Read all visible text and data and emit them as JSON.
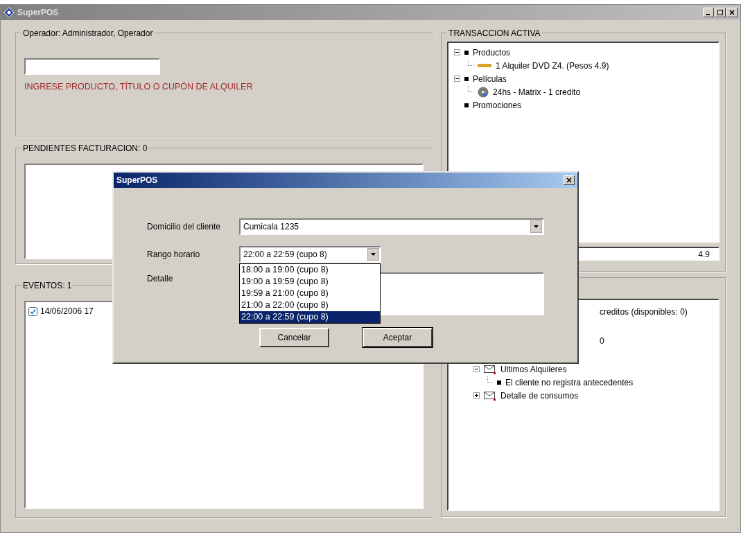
{
  "window": {
    "title": "SuperPOS"
  },
  "operator_panel": {
    "title": "Operador: Administrador, Operador",
    "hint": "INGRESE PRODUCTO, TÍTULO O CUPÓN DE ALQUILER"
  },
  "pending_panel": {
    "title": "PENDIENTES FACTURACION: 0"
  },
  "events_panel": {
    "title": "EVENTOS: 1",
    "items": [
      {
        "text": "14/06/2006 17",
        "checked": true
      }
    ]
  },
  "transaction_panel": {
    "title": "TRANSACCION ACTIVA",
    "total": "4.9",
    "tree": [
      {
        "label": "Productos",
        "kind": "bullet",
        "expanded": true,
        "children": [
          {
            "label": "1 Alquiler DVD Z4. (Pesos 4.9)",
            "kind": "ticket"
          }
        ]
      },
      {
        "label": "Películas",
        "kind": "bullet",
        "expanded": true,
        "children": [
          {
            "label": "24hs - Matrix - 1 credito",
            "kind": "disc"
          }
        ]
      },
      {
        "label": "Promociones",
        "kind": "bullet"
      }
    ]
  },
  "customer_panel": {
    "tree": [
      {
        "label": "creditos (disponibles: 0)",
        "kind": "partial"
      },
      {
        "label": "0",
        "kind": "partial"
      },
      {
        "label": "Ultimos Alquileres",
        "kind": "folder",
        "expanded": true,
        "children": [
          {
            "label": "El cliente no registra antecedentes",
            "kind": "bullet"
          }
        ]
      },
      {
        "label": "Detalle de consumos",
        "kind": "folder",
        "expanded": false
      }
    ]
  },
  "dialog": {
    "title": "SuperPOS",
    "address_label": "Domicilio del cliente",
    "address_value": "Cumicala 1235",
    "range_label": "Rango horario",
    "range_value": "22:00 a 22:59 (cupo 8)",
    "detail_label": "Detalle",
    "range_options": [
      {
        "text": "18:00 a 19:00 (cupo 8)",
        "selected": false
      },
      {
        "text": "19:00 a 19:59 (cupo 8)",
        "selected": false
      },
      {
        "text": "19:59 a 21:00 (cupo 8)",
        "selected": false
      },
      {
        "text": "21:00 a 22:00 (cupo 8)",
        "selected": false
      },
      {
        "text": "22:00 a 22:59 (cupo 8)",
        "selected": true
      }
    ],
    "buttons": [
      {
        "label": "Cancelar",
        "default": false
      },
      {
        "label": "Aceptar",
        "default": true
      }
    ]
  }
}
